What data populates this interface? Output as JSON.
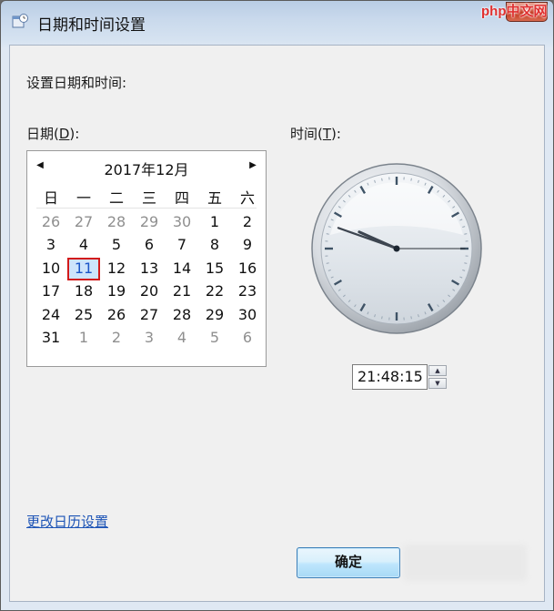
{
  "window": {
    "title": "日期和时间设置",
    "watermark": "php中文网"
  },
  "header": {
    "instruction": "设置日期和时间:"
  },
  "date_section": {
    "label_prefix": "日期(",
    "label_key": "D",
    "label_suffix": "):"
  },
  "time_section": {
    "label_prefix": "时间(",
    "label_key": "T",
    "label_suffix": "):",
    "time_value": "21:48:15"
  },
  "calendar": {
    "month_label": "2017年12月",
    "weekdays": [
      "日",
      "一",
      "二",
      "三",
      "四",
      "五",
      "六"
    ],
    "weeks": [
      [
        {
          "d": "26",
          "dim": true
        },
        {
          "d": "27",
          "dim": true
        },
        {
          "d": "28",
          "dim": true
        },
        {
          "d": "29",
          "dim": true
        },
        {
          "d": "30",
          "dim": true
        },
        {
          "d": "1"
        },
        {
          "d": "2"
        }
      ],
      [
        {
          "d": "3"
        },
        {
          "d": "4"
        },
        {
          "d": "5"
        },
        {
          "d": "6"
        },
        {
          "d": "7"
        },
        {
          "d": "8"
        },
        {
          "d": "9"
        }
      ],
      [
        {
          "d": "10"
        },
        {
          "d": "11",
          "selected": true
        },
        {
          "d": "12"
        },
        {
          "d": "13"
        },
        {
          "d": "14"
        },
        {
          "d": "15"
        },
        {
          "d": "16"
        }
      ],
      [
        {
          "d": "17"
        },
        {
          "d": "18"
        },
        {
          "d": "19"
        },
        {
          "d": "20"
        },
        {
          "d": "21"
        },
        {
          "d": "22"
        },
        {
          "d": "23"
        }
      ],
      [
        {
          "d": "24"
        },
        {
          "d": "25"
        },
        {
          "d": "26"
        },
        {
          "d": "27"
        },
        {
          "d": "28"
        },
        {
          "d": "29"
        },
        {
          "d": "30"
        }
      ],
      [
        {
          "d": "31"
        },
        {
          "d": "1",
          "dim": true
        },
        {
          "d": "2",
          "dim": true
        },
        {
          "d": "3",
          "dim": true
        },
        {
          "d": "4",
          "dim": true
        },
        {
          "d": "5",
          "dim": true
        },
        {
          "d": "6",
          "dim": true
        }
      ]
    ]
  },
  "clock": {
    "hour": 21,
    "minute": 48,
    "second": 15
  },
  "footer": {
    "calendar_link": "更改日历设置",
    "ok_label": "确定"
  },
  "colors": {
    "accent_link": "#1d54b6",
    "selected_border": "#d21a1a",
    "selected_bg": "#cde4fb"
  }
}
